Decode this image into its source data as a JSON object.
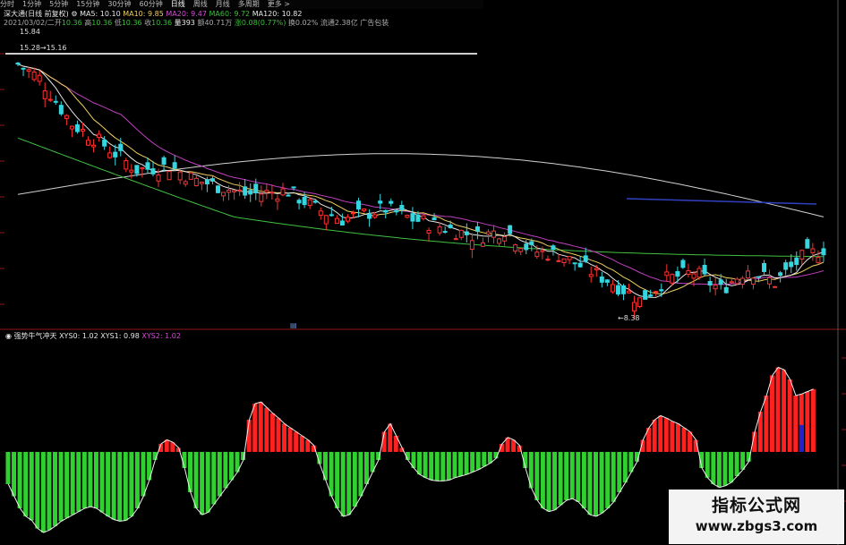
{
  "toolbar": {
    "items": [
      "分时",
      "1分钟",
      "5分钟",
      "15分钟",
      "30分钟",
      "60分钟",
      "日线",
      "周线",
      "月线",
      "多周期",
      "更多 >"
    ]
  },
  "info_line1": {
    "stock": "深大通(日线 前复权)",
    "ma5": "MA5: 10.10",
    "ma10": "MA10: 9.85",
    "ma20": "MA20: 9.47",
    "ma60": "MA60: 9.72",
    "ma120": "MA120: 10.82"
  },
  "info_line2": {
    "date": "2021/03/02/二",
    "open_label": "开",
    "open": "10.36",
    "high_label": "高",
    "high": "10.36",
    "low_label": "低",
    "low": "10.36",
    "close_label": "收",
    "close": "10.36",
    "volume": "量393",
    "amount": "额40.71万",
    "change": "涨0.08(0.77%)",
    "turnover": "换0.02%",
    "float": "流通2.38亿 广告包装"
  },
  "price_labels": {
    "high": "15.84",
    "range": "15.28→15.16",
    "low": "←8.38",
    "panel_marker": "▤"
  },
  "sub_header": {
    "name": "强势牛气冲天",
    "xys0": "XYS0: 1.02",
    "xys1": "XYS1: 0.98",
    "xys2": "XYS2: 1.02"
  },
  "watermark": {
    "title": "指标公式网",
    "url": "www.zbgs3.com"
  },
  "colors": {
    "up": "#ff3030",
    "down": "#35d6e0",
    "ma5": "#e6e6e6",
    "ma10": "#f0d060",
    "ma20": "#c040c0",
    "ma60": "#40c040",
    "ma120": "#d0d0d0",
    "blue_line": "#3040c0",
    "hist_pos": "#ff2020",
    "hist_neg": "#30d030",
    "hist_blue": "#2020d0"
  },
  "chart_data": [
    {
      "type": "line",
      "title": "深大通(日线 前复权)",
      "series": [
        {
          "name": "MA5",
          "values": []
        },
        {
          "name": "MA10",
          "values": []
        },
        {
          "name": "MA20",
          "values": []
        },
        {
          "name": "MA60",
          "values": []
        },
        {
          "name": "MA120",
          "values": []
        }
      ],
      "annotations": [
        "15.84",
        "15.28→15.16",
        "←8.38"
      ],
      "last_values": {
        "MA5": 10.1,
        "MA10": 9.85,
        "MA20": 9.47,
        "MA60": 9.72,
        "MA120": 10.82
      }
    },
    {
      "type": "bar",
      "title": "强势牛气冲天",
      "series": [
        {
          "name": "XYS0",
          "last": 1.02
        },
        {
          "name": "XYS1",
          "last": 0.98
        },
        {
          "name": "XYS2",
          "last": 1.02
        }
      ],
      "values": [
        -0.4,
        -0.55,
        -0.7,
        -0.8,
        -0.85,
        -0.95,
        -1.0,
        -0.97,
        -0.92,
        -0.86,
        -0.82,
        -0.78,
        -0.74,
        -0.7,
        -0.68,
        -0.7,
        -0.75,
        -0.8,
        -0.84,
        -0.86,
        -0.85,
        -0.8,
        -0.7,
        -0.55,
        -0.35,
        -0.1,
        0.1,
        0.15,
        0.12,
        0.05,
        -0.2,
        -0.5,
        -0.7,
        -0.78,
        -0.75,
        -0.65,
        -0.55,
        -0.45,
        -0.35,
        -0.25,
        -0.1,
        0.4,
        0.6,
        0.62,
        0.55,
        0.48,
        0.42,
        0.35,
        0.3,
        0.25,
        0.2,
        0.15,
        0.08,
        -0.15,
        -0.35,
        -0.55,
        -0.7,
        -0.8,
        -0.78,
        -0.68,
        -0.55,
        -0.4,
        -0.25,
        -0.1,
        0.25,
        0.35,
        0.2,
        0.05,
        -0.1,
        -0.2,
        -0.28,
        -0.32,
        -0.35,
        -0.36,
        -0.36,
        -0.35,
        -0.32,
        -0.3,
        -0.28,
        -0.25,
        -0.22,
        -0.18,
        -0.14,
        -0.08,
        0.1,
        0.18,
        0.15,
        0.08,
        -0.2,
        -0.45,
        -0.6,
        -0.7,
        -0.74,
        -0.72,
        -0.66,
        -0.6,
        -0.58,
        -0.62,
        -0.7,
        -0.78,
        -0.8,
        -0.76,
        -0.7,
        -0.62,
        -0.5,
        -0.38,
        -0.25,
        -0.12,
        0.15,
        0.3,
        0.4,
        0.45,
        0.42,
        0.38,
        0.35,
        0.3,
        0.25,
        0.15,
        -0.2,
        -0.32,
        -0.4,
        -0.44,
        -0.42,
        -0.38,
        -0.3,
        -0.22,
        -0.12,
        0.25,
        0.5,
        0.7,
        0.95,
        1.05,
        1.02,
        0.9,
        0.7,
        0.72,
        0.75,
        0.78
      ]
    }
  ]
}
